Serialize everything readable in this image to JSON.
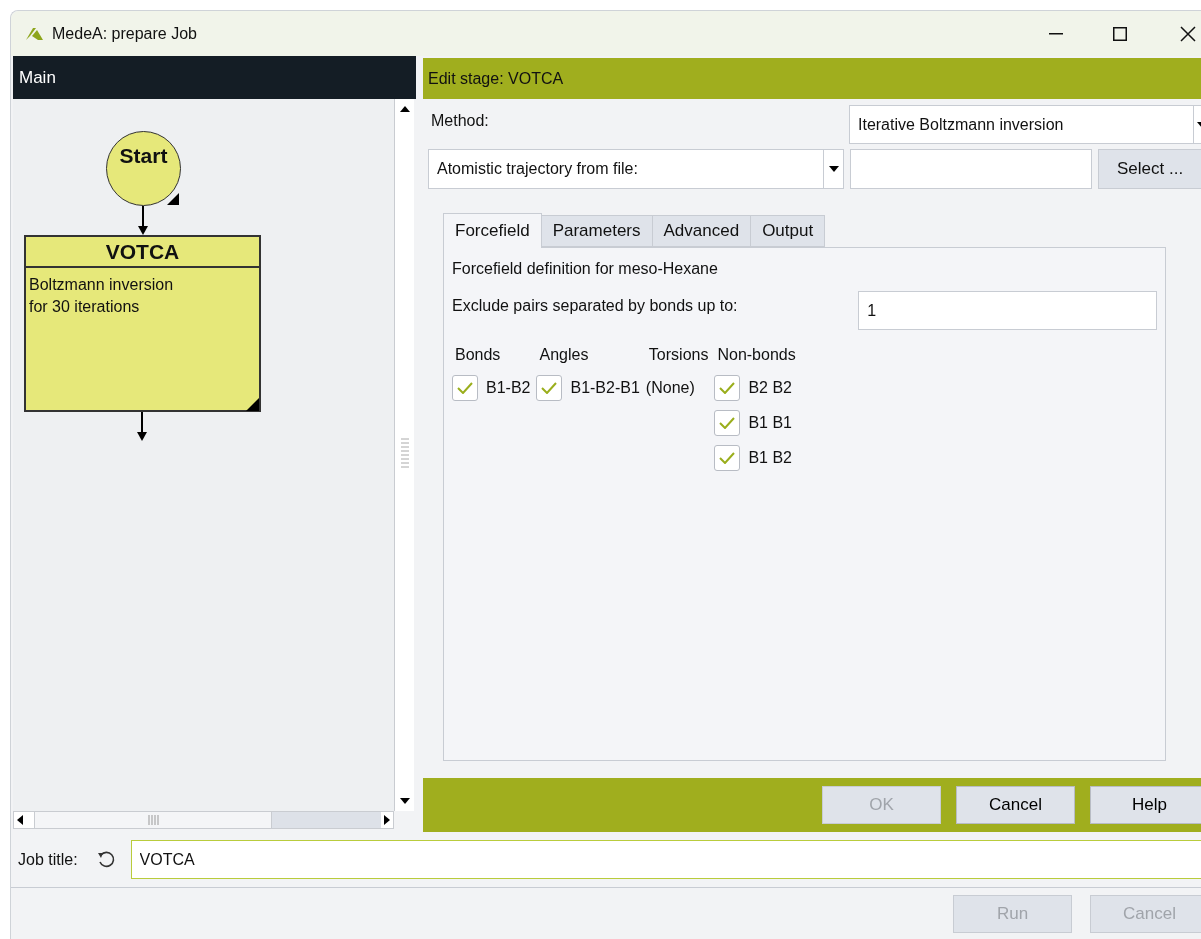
{
  "window": {
    "title": "MedeA: prepare Job"
  },
  "flowchart": {
    "title": "Main",
    "nodes": [
      {
        "kind": "start",
        "label": "Start"
      },
      {
        "kind": "stage",
        "title": "VOTCA",
        "description": "Boltzmann inversion\nfor 30 iterations"
      }
    ]
  },
  "editor": {
    "title": "Edit stage: VOTCA",
    "method_label": "Method:",
    "method_value": "Iterative Boltzmann inversion",
    "source_value": "Atomistic trajectory from file:",
    "select_button": "Select ...",
    "tabs": [
      {
        "label": "Forcefield",
        "selected": true
      },
      {
        "label": "Parameters",
        "selected": false
      },
      {
        "label": "Advanced",
        "selected": false
      },
      {
        "label": "Output",
        "selected": false
      }
    ],
    "forcefield": {
      "heading": "Forcefield definition for meso-Hexane",
      "exclude_label": "Exclude pairs separated by bonds up to:",
      "exclude_value": "1",
      "groups": [
        {
          "title": "Bonds",
          "items": [
            {
              "kind": "checkbox",
              "label": "B1-B2",
              "checked": true
            }
          ]
        },
        {
          "title": "Angles",
          "items": [
            {
              "kind": "checkbox",
              "label": "B1-B2-B1",
              "checked": true
            }
          ]
        },
        {
          "title": "Torsions",
          "items": [
            {
              "kind": "text",
              "label": "(None)"
            }
          ]
        },
        {
          "title": "Non-bonds",
          "items": [
            {
              "kind": "checkbox",
              "label": "B2 B2",
              "checked": true
            },
            {
              "kind": "checkbox",
              "label": "B1 B1",
              "checked": true
            },
            {
              "kind": "checkbox",
              "label": "B1 B2",
              "checked": true
            }
          ]
        }
      ]
    },
    "buttons": [
      {
        "label": "OK",
        "disabled": true
      },
      {
        "label": "Cancel",
        "disabled": false
      },
      {
        "label": "Help",
        "disabled": false
      }
    ]
  },
  "job_title": {
    "label": "Job title:",
    "value": "VOTCA"
  },
  "footer_buttons": [
    {
      "label": "Run",
      "disabled": true
    },
    {
      "label": "Cancel",
      "disabled": true
    }
  ]
}
